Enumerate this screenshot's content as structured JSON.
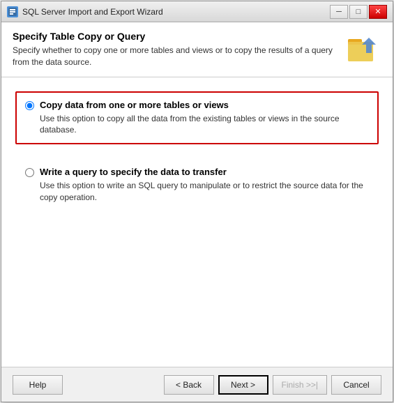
{
  "window": {
    "title": "SQL Server Import and Export Wizard",
    "icon": "db-icon"
  },
  "titlebar": {
    "minimize": "─",
    "restore": "□",
    "close": "✕"
  },
  "header": {
    "title": "Specify Table Copy or Query",
    "subtitle": "Specify whether to copy one or more tables and views or to copy the results of a query\nfrom the data source."
  },
  "options": [
    {
      "id": "copy-tables",
      "label": "Copy data from one or more tables or views",
      "description": "Use this option to copy all the data from the existing tables or views in the source database.",
      "selected": true
    },
    {
      "id": "write-query",
      "label": "Write a query to specify the data to transfer",
      "description": "Use this option to write an SQL query to manipulate or to restrict the source data for the copy\noperation.",
      "selected": false
    }
  ],
  "footer": {
    "help_label": "Help",
    "back_label": "< Back",
    "next_label": "Next >",
    "finish_label": "Finish >>|",
    "cancel_label": "Cancel"
  }
}
